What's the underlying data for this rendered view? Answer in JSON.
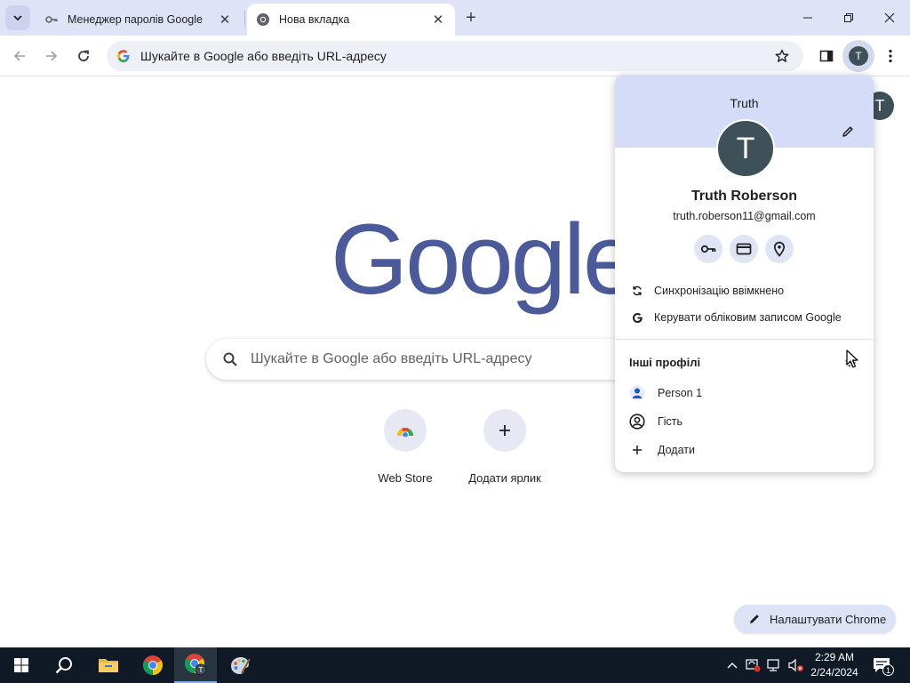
{
  "browser": {
    "tabs": [
      {
        "title": "Менеджер паролів Google",
        "active": false,
        "favicon": "key-icon"
      },
      {
        "title": "Нова вкладка",
        "active": true,
        "favicon": "chrome-icon"
      }
    ],
    "omnibox": {
      "text": "Шукайте в Google або введіть URL-адресу"
    },
    "profile_initial": "T"
  },
  "ntp": {
    "logo_text": "Google",
    "search_placeholder": "Шукайте в Google або введіть URL-адресу",
    "avatar_initial": "T",
    "shortcuts": [
      {
        "label": "Web Store",
        "icon": "webstore-icon"
      },
      {
        "label": "Додати ярлик",
        "icon": "plus-icon"
      }
    ],
    "customize_label": "Налаштувати Chrome"
  },
  "profile_menu": {
    "header_name": "Truth",
    "avatar_initial": "T",
    "full_name": "Truth Roberson",
    "email": "truth.roberson11@gmail.com",
    "quick_actions": [
      "key-icon",
      "card-icon",
      "location-icon"
    ],
    "sync_label": "Синхронізацію ввімкнено",
    "manage_label": "Керувати обліковим записом Google",
    "other_profiles_title": "Інші профілі",
    "profiles": [
      {
        "label": "Person 1",
        "icon": "person-icon"
      },
      {
        "label": "Гість",
        "icon": "guest-icon"
      },
      {
        "label": "Додати",
        "icon": "plus-icon"
      }
    ]
  },
  "taskbar": {
    "time": "2:29 AM",
    "date": "2/24/2024",
    "notification_count": "1"
  },
  "colors": {
    "tabstrip": "#dfe3f7",
    "popup_header": "#d4dcf8",
    "avatar": "#3e5158",
    "logo": "#4a5a9a",
    "taskbar": "#101a26"
  }
}
